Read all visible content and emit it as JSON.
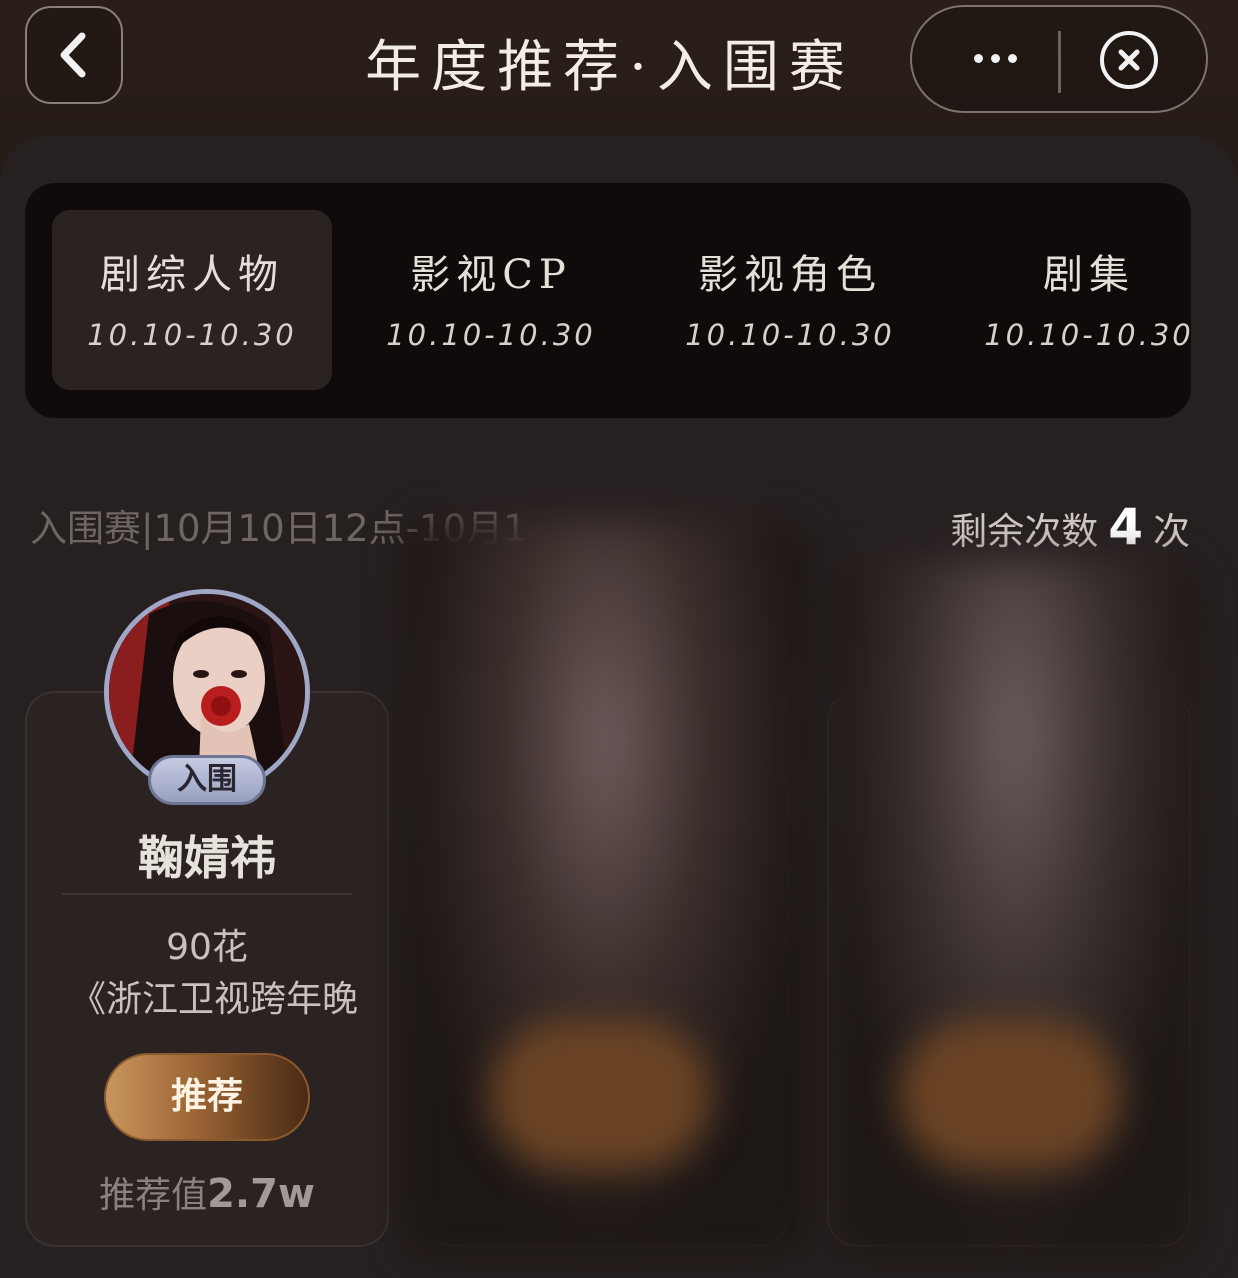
{
  "header": {
    "title": "年度推荐·入围赛",
    "back_icon": "chevron-left-icon",
    "more_icon": "more-dots-icon",
    "close_icon": "close-circle-icon"
  },
  "tabs": [
    {
      "label": "剧综人物",
      "date": "10.10-10.30",
      "active": true
    },
    {
      "label": "影视CP",
      "date": "10.10-10.30",
      "active": false
    },
    {
      "label": "影视角色",
      "date": "10.10-10.30",
      "active": false
    },
    {
      "label": "剧集",
      "date": "10.10-10.30",
      "active": false
    }
  ],
  "round_info": "入围赛|10月10日12点-10月1",
  "remaining": {
    "prefix": "剩余次数",
    "count": "4",
    "suffix": "次"
  },
  "cards": [
    {
      "badge": "入围",
      "name": "鞠婧祎",
      "tag": "90花",
      "work": "《浙江卫视跨年晚",
      "button": "推荐",
      "value_label": "推荐值",
      "value": "2.7w"
    }
  ],
  "colors": {
    "background": "#221b19",
    "tab_bar": "#0f0b0a",
    "button_gradient_start": "#c9955e",
    "button_gradient_end": "#4a2a15",
    "badge": "#9aa1c0"
  }
}
